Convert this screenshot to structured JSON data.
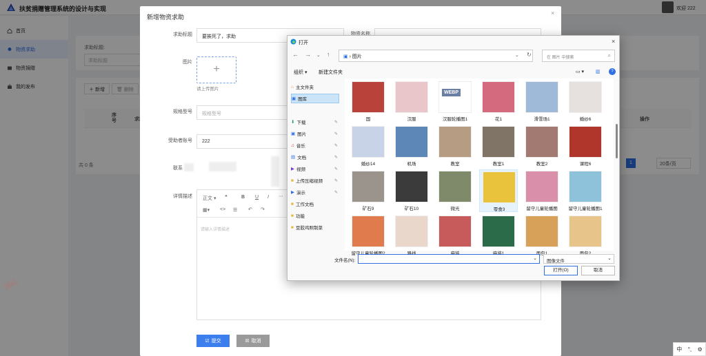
{
  "app": {
    "title": "扶贫捐赠管理系统的设计与实现",
    "welcome": "欢迎 222",
    "accent_color": "#2f6fe0"
  },
  "sidebar": {
    "items": [
      {
        "label": "首页",
        "icon": "home-icon"
      },
      {
        "label": "物资求助",
        "icon": "location-icon",
        "active": true
      },
      {
        "label": "物资捐赠",
        "icon": "box-icon"
      },
      {
        "label": "我的发布",
        "icon": "briefcase-icon"
      }
    ]
  },
  "page": {
    "search_label": "求助标题:",
    "search_placeholder": "求助标题",
    "add_label": "新增",
    "delete_label": "删除",
    "columns": {
      "seq": "序号",
      "title": "求助标",
      "action": "操作"
    },
    "total": "共 0 条",
    "current_page": "1",
    "page_size": "20条/页"
  },
  "modal": {
    "title": "新增物资求助",
    "fields": {
      "title_label": "求助标题",
      "title_value": "要挨死了，求助",
      "material_label": "物资名称",
      "image_label": "图片",
      "upload_hint": "请上传图片",
      "spec_label": "规格型号",
      "spec_placeholder": "规格型号",
      "account_label": "受助者账号",
      "account_value": "222",
      "contact_label": "联系",
      "detail_label": "详情描述"
    },
    "editor": {
      "paragraph": "正文",
      "quote": "❝",
      "bold": "B",
      "underline": "U",
      "italic": "I",
      "placeholder": "请输入详情描述"
    },
    "submit_label": "提交",
    "cancel_label": "取消"
  },
  "file_dialog": {
    "title": "打开",
    "path": "图片",
    "search_placeholder": "在 图片 中搜索",
    "organize": "组织",
    "new_folder": "新建文件夹",
    "tree": [
      {
        "label": "主文件夹",
        "icon": "home-icon"
      },
      {
        "label": "图库",
        "icon": "gallery-icon",
        "selected": true
      },
      {
        "label": "下载",
        "icon": "download-icon",
        "pinned": true
      },
      {
        "label": "图片",
        "icon": "pictures-icon",
        "pinned": true
      },
      {
        "label": "音乐",
        "icon": "music-icon",
        "pinned": true
      },
      {
        "label": "文档",
        "icon": "document-icon",
        "pinned": true
      },
      {
        "label": "视频",
        "icon": "video-icon",
        "pinned": true
      },
      {
        "label": "上传压缩视频",
        "icon": "folder-icon",
        "pinned": true
      },
      {
        "label": "演示",
        "icon": "play-icon",
        "pinned": true
      },
      {
        "label": "工作文档",
        "icon": "folder-icon"
      },
      {
        "label": "功能",
        "icon": "folder-icon"
      },
      {
        "label": "豆胶鸡照制菜",
        "icon": "folder-icon"
      }
    ],
    "files": [
      {
        "name": "国",
        "color": "#b9433b"
      },
      {
        "name": "汉服",
        "color": "#e9c6c9"
      },
      {
        "name": "汉服轮播图1",
        "color": "#dfe6ee",
        "webp": "WEBP"
      },
      {
        "name": "花1",
        "color": "#d46a7e"
      },
      {
        "name": "滑雪场1",
        "color": "#9fb9d9"
      },
      {
        "name": "婚纱6",
        "color": "#e6e1de"
      },
      {
        "name": "婚纱14",
        "color": "#c8d3e7"
      },
      {
        "name": "机场",
        "color": "#5d87b7"
      },
      {
        "name": "教室",
        "color": "#b59c82"
      },
      {
        "name": "教室1",
        "color": "#7f7466"
      },
      {
        "name": "教室2",
        "color": "#a27a72"
      },
      {
        "name": "课程6",
        "color": "#b0352a"
      },
      {
        "name": "矿石9",
        "color": "#9a948d"
      },
      {
        "name": "矿石10",
        "color": "#3b3b3b"
      },
      {
        "name": "微光",
        "color": "#7e8a6a"
      },
      {
        "name": "零食3",
        "color": "#e8c33b",
        "selected": true
      },
      {
        "name": "留守儿童轮播图",
        "color": "#d98ea9"
      },
      {
        "name": "留守儿童轮播图1",
        "color": "#8ec1da"
      },
      {
        "name": "留守儿童轮播图2",
        "color": "#e07b4d"
      },
      {
        "name": "路线",
        "color": "#e9d7cc"
      },
      {
        "name": "麻将",
        "color": "#c75a5a"
      },
      {
        "name": "麻将1",
        "color": "#2c6b4a"
      },
      {
        "name": "面包1",
        "color": "#d8a15a"
      },
      {
        "name": "面包2",
        "color": "#e6c48a"
      }
    ],
    "filename_label": "文件名(N):",
    "filetype": "图像文件",
    "open_label": "打开(O)",
    "cancel_label": "取消"
  },
  "ime": {
    "lang": "中",
    "punct": "°,",
    "mode": "⚙"
  }
}
